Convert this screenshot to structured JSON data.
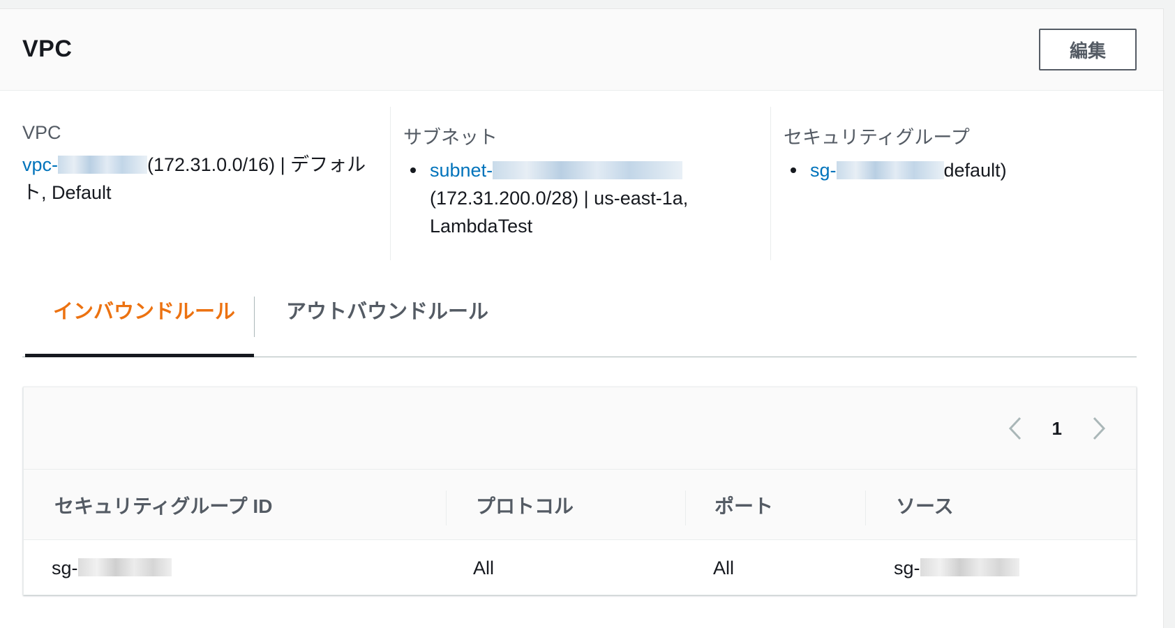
{
  "panel": {
    "title": "VPC",
    "edit_label": "編集"
  },
  "vpc": {
    "label": "VPC",
    "link_prefix": "vpc-",
    "detail": "(172.31.0.0/16) | デフォルト, Default"
  },
  "subnet": {
    "label": "サブネット",
    "link_prefix": "subnet-",
    "detail": "(172.31.200.0/28) | us-east-1a, LambdaTest"
  },
  "security_groups": {
    "label": "セキュリティグループ",
    "link_prefix": "sg-",
    "detail": "default)"
  },
  "tabs": {
    "inbound": "インバウンドルール",
    "outbound": "アウトバウンドルール",
    "active": "inbound"
  },
  "table": {
    "page": "1",
    "columns": [
      "セキュリティグループ ID",
      "プロトコル",
      "ポート",
      "ソース"
    ],
    "rows": [
      {
        "sg_prefix": "sg-",
        "protocol": "All",
        "port": "All",
        "source_prefix": "sg-"
      }
    ]
  },
  "icons": {
    "prev": "chevron-left-icon",
    "next": "chevron-right-icon"
  },
  "colors": {
    "link": "#0073bb",
    "active_tab": "#ec7211",
    "text": "#16191f",
    "muted": "#545b64"
  }
}
